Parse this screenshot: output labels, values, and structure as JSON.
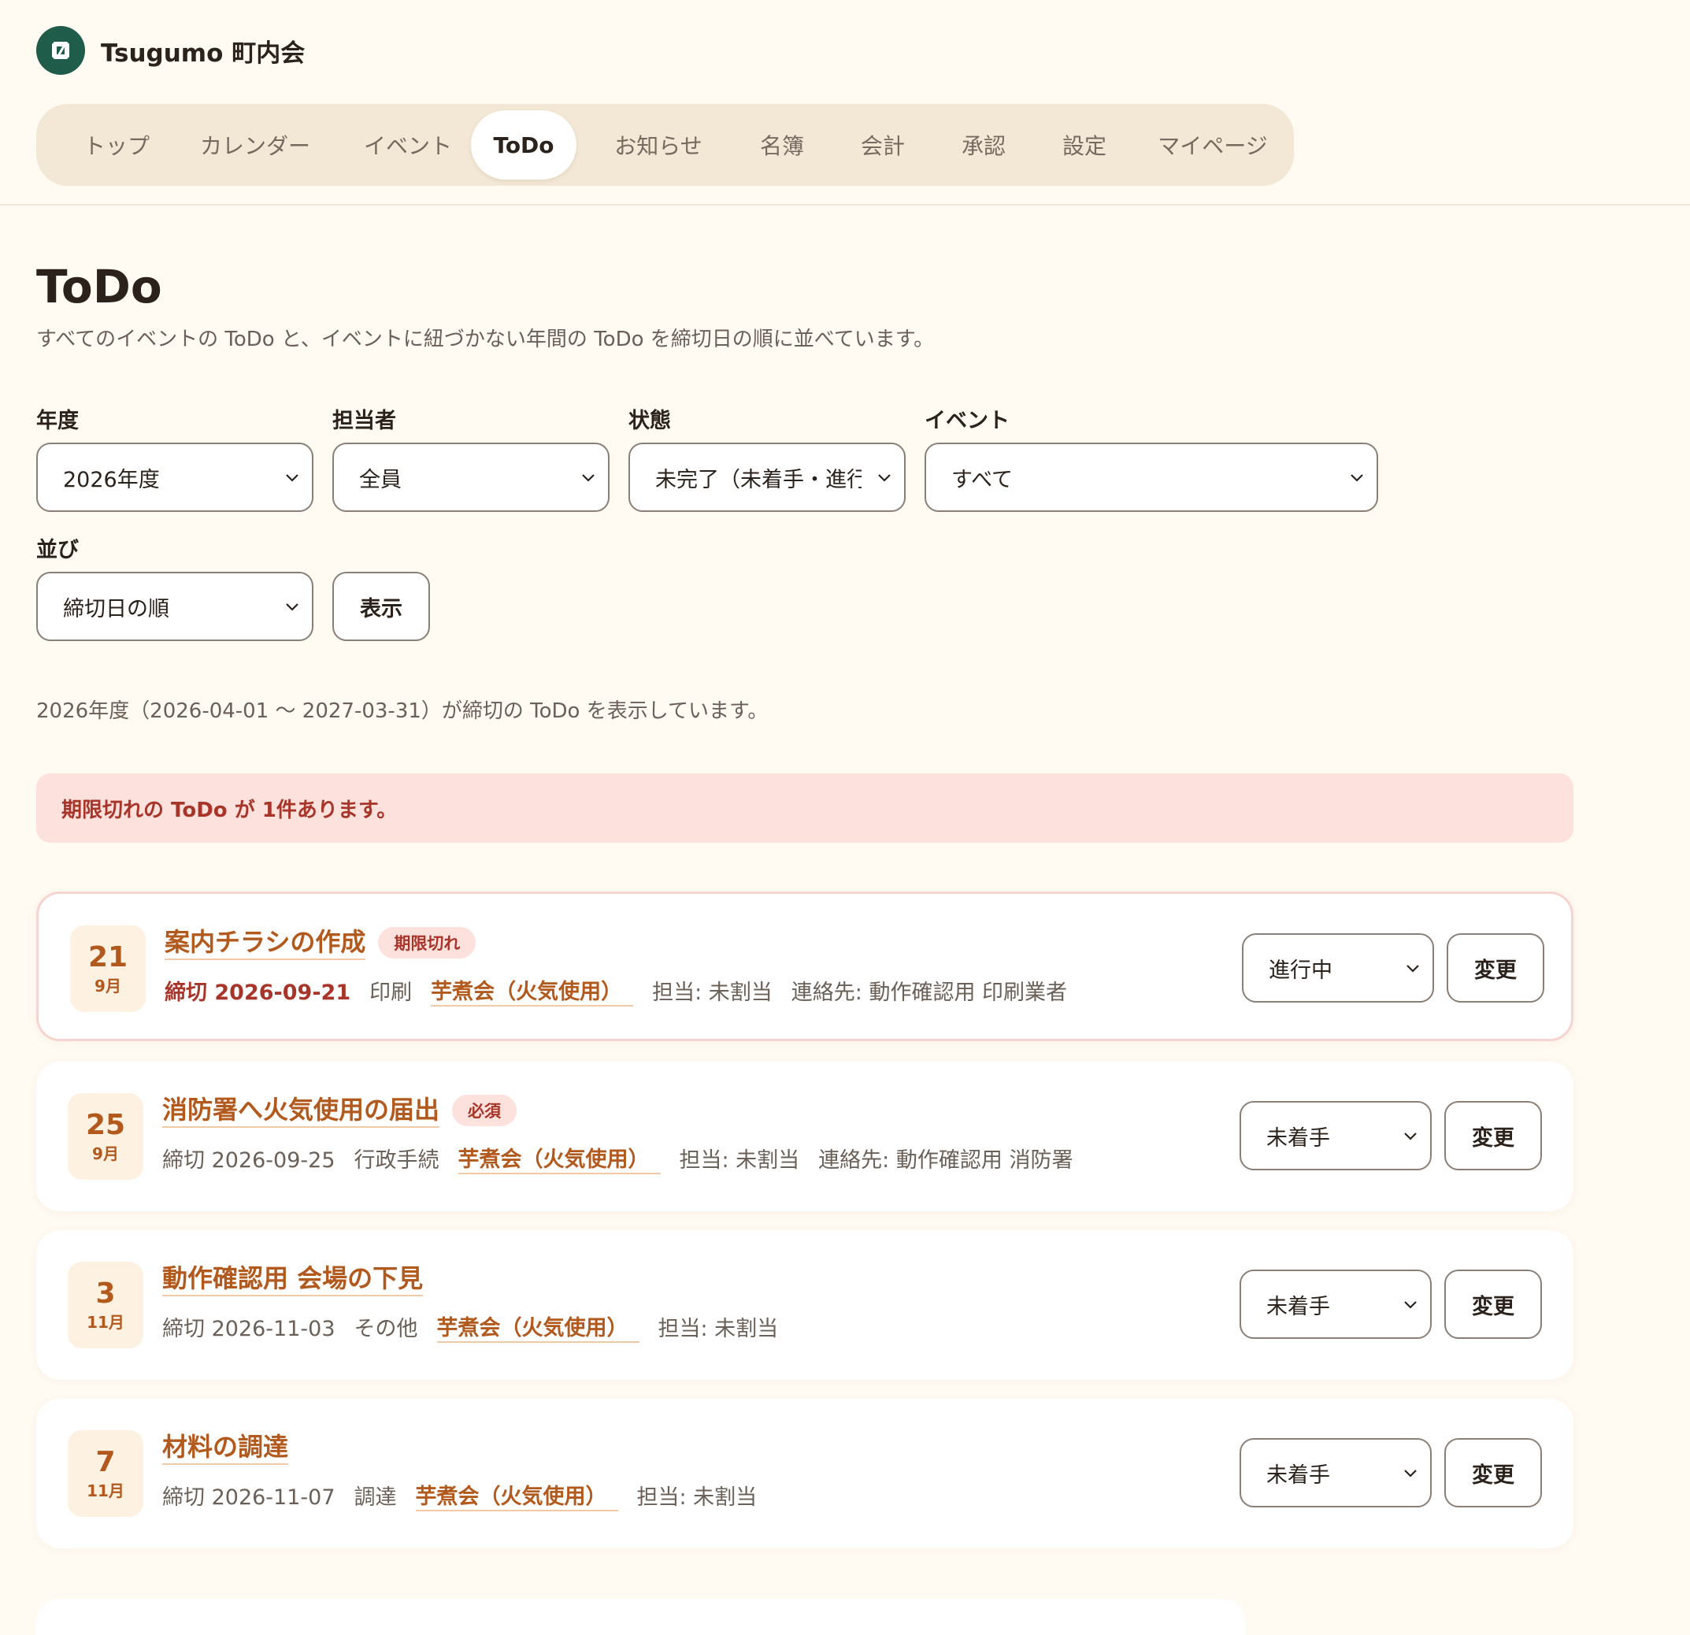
{
  "app": {
    "name": "Tsugumo 町内会"
  },
  "nav": {
    "items": [
      {
        "label": "トップ"
      },
      {
        "label": "カレンダー"
      },
      {
        "label": "イベント"
      },
      {
        "label": "ToDo",
        "active": true
      },
      {
        "label": "お知らせ"
      },
      {
        "label": "名簿"
      },
      {
        "label": "会計"
      },
      {
        "label": "承認"
      },
      {
        "label": "設定"
      },
      {
        "label": "マイページ"
      }
    ]
  },
  "page": {
    "title": "ToDo",
    "description": "すべてのイベントの ToDo と、イベントに紐づかない年間の ToDo を締切日の順に並べています。"
  },
  "filters": {
    "year": {
      "label": "年度",
      "value": "2026年度"
    },
    "assignee": {
      "label": "担当者",
      "value": "全員"
    },
    "status": {
      "label": "状態",
      "value": "未完了（未着手・進行中）"
    },
    "event": {
      "label": "イベント",
      "value": "すべて"
    },
    "sort": {
      "label": "並び",
      "value": "締切日の順"
    },
    "submit_label": "表示"
  },
  "range_note": "2026年度（2026-04-01 〜 2027-03-31）が締切の ToDo を表示しています。",
  "alert": "期限切れの ToDo が 1件あります。",
  "todos": [
    {
      "day": "21",
      "month": "9月",
      "title": "案内チラシの作成",
      "badge": "期限切れ",
      "due": "締切 2026-09-21",
      "category": "印刷",
      "event": "芋煮会（火気使用）",
      "assignee": "担当: 未割当",
      "contact": "連絡先: 動作確認用 印刷業者",
      "status": "進行中",
      "change_label": "変更"
    },
    {
      "day": "25",
      "month": "9月",
      "title": "消防署へ火気使用の届出",
      "badge": "必須",
      "due": "締切 2026-09-25",
      "category": "行政手続",
      "event": "芋煮会（火気使用）",
      "assignee": "担当: 未割当",
      "contact": "連絡先: 動作確認用 消防署",
      "status": "未着手",
      "change_label": "変更"
    },
    {
      "day": "3",
      "month": "11月",
      "title": "動作確認用 会場の下見",
      "due": "締切 2026-11-03",
      "category": "その他",
      "event": "芋煮会（火気使用）",
      "assignee": "担当: 未割当",
      "status": "未着手",
      "change_label": "変更"
    },
    {
      "day": "7",
      "month": "11月",
      "title": "材料の調達",
      "due": "締切 2026-11-07",
      "category": "調達",
      "event": "芋煮会（火気使用）",
      "assignee": "担当: 未割当",
      "status": "未着手",
      "change_label": "変更"
    }
  ]
}
